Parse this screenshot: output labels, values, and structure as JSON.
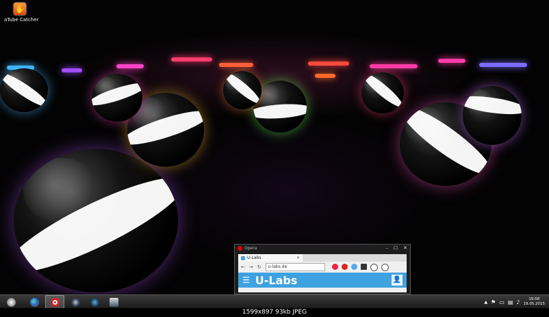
{
  "desktop": {
    "icon": {
      "label": "aTube Catcher",
      "icon": "hand-icon"
    }
  },
  "preview": {
    "window_title": "Opera",
    "controls": [
      "–",
      "☐",
      "✕"
    ],
    "tab_title": "U-Labs",
    "tab_close": "✕",
    "nav": {
      "back": "←",
      "forward": "→",
      "reload": "↻"
    },
    "url": "u-labs.de",
    "site": {
      "menu": "☰",
      "brand": "U-Labs",
      "user": "👤"
    }
  },
  "taskbar": {
    "start": "start-orb-icon",
    "apps": [
      "firefox-icon",
      "opera-icon",
      "steam-icon",
      "update-icon",
      "launcher-icon"
    ],
    "active_app": "opera-icon"
  },
  "tray": {
    "chevron": "▲",
    "time": "19:58",
    "date": "19.05.2015"
  },
  "caption": "1599x897 93kb JPEG",
  "colors": {
    "accent": "#3fa2e0",
    "opera": "#cc1b1b"
  }
}
